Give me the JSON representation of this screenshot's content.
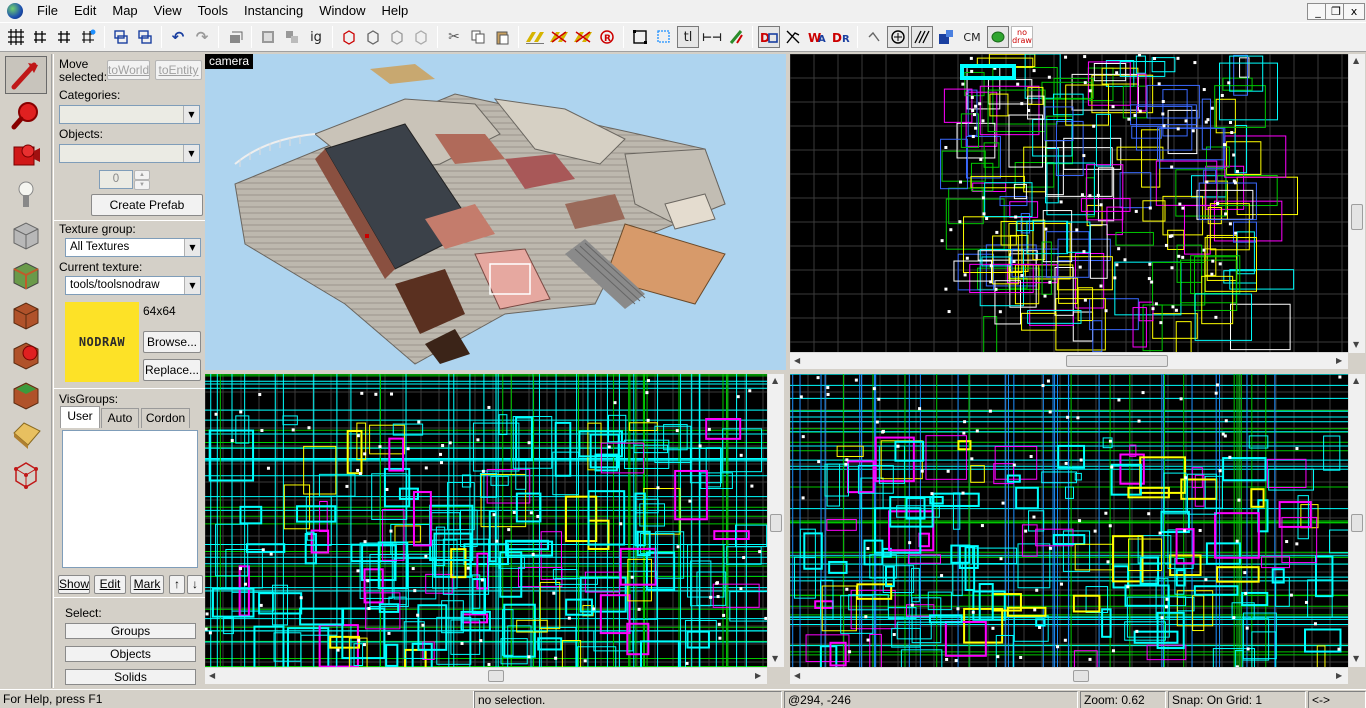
{
  "menu": [
    "File",
    "Edit",
    "Map",
    "View",
    "Tools",
    "Instancing",
    "Window",
    "Help"
  ],
  "window_controls": [
    "_",
    "❐",
    "x"
  ],
  "toolbar": {
    "undo_icon": "↶",
    "redo_icon": "↷",
    "ig_label": "ig",
    "tl_label": "tl",
    "cm_label": "CM",
    "nodraw_label_top": "no",
    "nodraw_label_bottom": "draw"
  },
  "tools": [
    "selection-tool",
    "magnify-tool",
    "camera-tool",
    "entity-tool",
    "block-tool",
    "texture-tool",
    "apply-texture-tool",
    "decal-tool",
    "overlay-tool",
    "clipping-tool",
    "vertex-tool"
  ],
  "side": {
    "move_label": "Move",
    "selected_label": "selected:",
    "to_world": "toWorld",
    "to_entity": "toEntity",
    "categories_label": "Categories:",
    "objects_label": "Objects:",
    "spin_value": "0",
    "create_prefab": "Create Prefab",
    "texture_group_label": "Texture group:",
    "texture_group_value": "All Textures",
    "current_texture_label": "Current texture:",
    "current_texture_value": "tools/toolsnodraw",
    "texture_preview_text": "NODRAW",
    "texture_size": "64x64",
    "browse": "Browse...",
    "replace": "Replace...",
    "visgroups_label": "VisGroups:",
    "tabs": [
      "User",
      "Auto",
      "Cordon"
    ],
    "show": "Show",
    "edit": "Edit",
    "mark": "Mark",
    "up_arrow": "↑",
    "down_arrow": "↓",
    "select_label": "Select:",
    "groups": "Groups",
    "objects": "Objects",
    "solids": "Solids"
  },
  "viewports": {
    "camera_label": "camera"
  },
  "status": {
    "help": "For Help, press F1",
    "selection": "no selection.",
    "coords": "@294, -246",
    "zoom": "Zoom: 0.62",
    "snap": "Snap: On Grid: 1",
    "extra": "<->"
  },
  "colors": {
    "cyan": "#00ffff",
    "green": "#00c800",
    "yellow": "#ffff00",
    "magenta": "#ff00ff",
    "grid": "#3a3a3a",
    "sky": "#aed4ef",
    "nodraw": "#fde227"
  }
}
